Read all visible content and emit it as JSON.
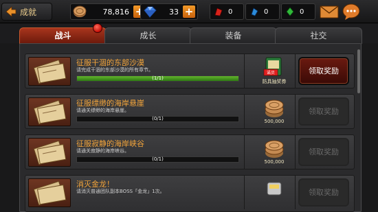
{
  "header": {
    "back_label": "成就",
    "coins": "78,816",
    "gems": "33",
    "red_crystal": "0",
    "blue_crystal": "0",
    "green_crystal": "0",
    "icons": [
      "coin-icon",
      "gem-icon",
      "red-crystal-icon",
      "blue-crystal-icon",
      "green-crystal-icon",
      "mail-icon",
      "chat-icon"
    ]
  },
  "tabs": [
    {
      "label": "战斗",
      "active": true
    },
    {
      "label": "成长",
      "active": false
    },
    {
      "label": "装备",
      "active": false
    },
    {
      "label": "社交",
      "active": false
    }
  ],
  "achievements": [
    {
      "title": "征服干涸的东部沙漠",
      "desc": "请完成干涸的东部沙漠的所有章节。",
      "progress": "(1/1)",
      "progress_fraction": 1.0,
      "reward_label": "防具抽奖券",
      "reward_badge": "诺贝",
      "reward_icon": "voucher-icon",
      "claim_label": "领取奖励",
      "claimable": true
    },
    {
      "title": "征服缥缈的海岸悬崖",
      "desc": "请通关缥缈的海岸悬崖。",
      "progress": "(0/1)",
      "progress_fraction": 0.0,
      "reward_label": "500,000",
      "reward_icon": "coin-stack-icon",
      "claim_label": "领取奖励",
      "claimable": false
    },
    {
      "title": "征服寂静的海岸峡谷",
      "desc": "请通关寂静的海岸峡谷。",
      "progress": "(0/1)",
      "progress_fraction": 0.0,
      "reward_label": "500,000",
      "reward_icon": "coin-stack-icon",
      "claim_label": "领取奖励",
      "claimable": false
    },
    {
      "title": "消灭金龙！",
      "desc": "请消灭普通团队副本BOSS「金龙」1次。",
      "progress": "",
      "progress_fraction": 0.0,
      "reward_label": "",
      "reward_icon": "trophy-icon",
      "claim_label": "领取奖励",
      "claimable": false
    }
  ],
  "colors": {
    "title": "#f2a43b",
    "active_tab": "#a8351d",
    "progress_fill": "#64b52d"
  }
}
